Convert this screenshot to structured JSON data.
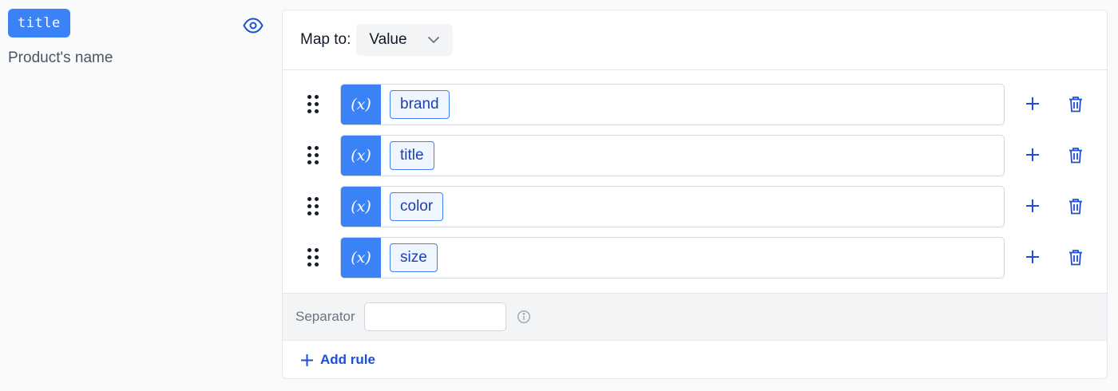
{
  "attribute": {
    "name": "title",
    "description": "Product's name"
  },
  "mapping": {
    "label": "Map to:",
    "selected": "Value",
    "var_symbol": "(x)",
    "rules": [
      {
        "variable": "brand"
      },
      {
        "variable": "title"
      },
      {
        "variable": "color"
      },
      {
        "variable": "size"
      }
    ],
    "separator": {
      "label": "Separator",
      "value": ""
    },
    "add_rule_label": "Add rule"
  },
  "colors": {
    "accent": "#3b82f6",
    "chip_bg": "#eff6ff",
    "link": "#1d4ed8"
  },
  "icons": [
    "eye-icon",
    "chevron-down-icon",
    "drag-handle-icon",
    "variable-icon",
    "plus-icon",
    "trash-icon",
    "info-icon"
  ]
}
